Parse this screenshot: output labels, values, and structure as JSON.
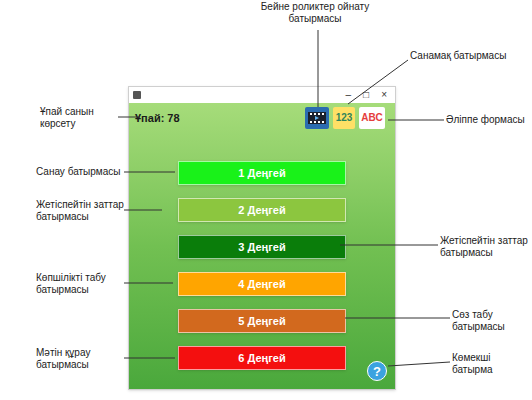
{
  "window": {
    "controls": [
      "–",
      "□",
      "×"
    ]
  },
  "score": "Ұпай: 78",
  "toolbar": {
    "numbers": "123",
    "alphabet": "ABC"
  },
  "levels": [
    {
      "label": "1 Деңгей",
      "color": "#19f219"
    },
    {
      "label": "2 Деңгей",
      "color": "#8cc63f"
    },
    {
      "label": "3 Деңгей",
      "color": "#0a7d0a"
    },
    {
      "label": "4 Деңгей",
      "color": "#ffa500"
    },
    {
      "label": "5 Деңгей",
      "color": "#d2691e"
    },
    {
      "label": "6 Деңгей",
      "color": "#f40f0f"
    }
  ],
  "help": "?",
  "callouts": [
    "Бейне роликтер ойнату батырмасы",
    "Санамақ батырмасы",
    "Әліппе формасы",
    "Ұпай санын көрсету",
    "Санау батырмасы",
    "Жетіспейтін заттар батырмасы",
    "Жетіспейтін заттар батырмасы",
    "Көпшілікті табу батырмасы",
    "Сөз табу батырмасы",
    "Мәтін құрау батырмасы",
    "Көмекші батырма"
  ]
}
